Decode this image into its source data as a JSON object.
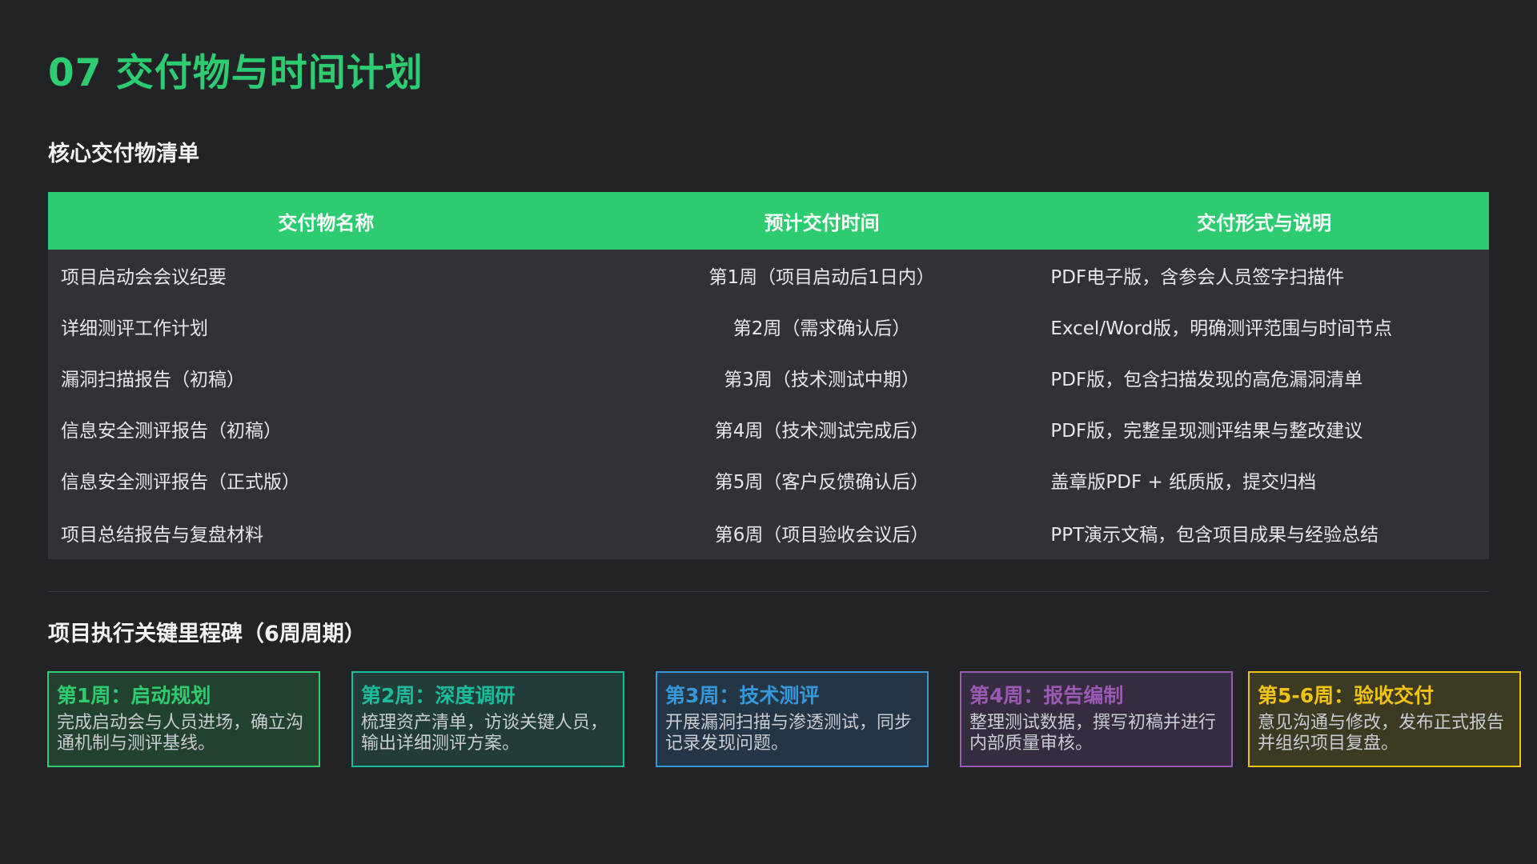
{
  "page": {
    "title": "07 交付物与时间计划"
  },
  "deliverables": {
    "section_title": "核心交付物清单",
    "columns": [
      "交付物名称",
      "预计交付时间",
      "交付形式与说明"
    ],
    "rows": [
      [
        "项目启动会会议纪要",
        "第1周（项目启动后1日内）",
        "PDF电子版，含参会人员签字扫描件"
      ],
      [
        "详细测评工作计划",
        "第2周（需求确认后）",
        "Excel/Word版，明确测评范围与时间节点"
      ],
      [
        "漏洞扫描报告（初稿）",
        "第3周（技术测试中期）",
        "PDF版，包含扫描发现的高危漏洞清单"
      ],
      [
        "信息安全测评报告（初稿）",
        "第4周（技术测试完成后）",
        "PDF版，完整呈现测评结果与整改建议"
      ],
      [
        "信息安全测评报告（正式版）",
        "第5周（客户反馈确认后）",
        "盖章版PDF + 纸质版，提交归档"
      ],
      [
        "项目总结报告与复盘材料",
        "第6周（项目验收会议后）",
        "PPT演示文稿，包含项目成果与经验总结"
      ]
    ]
  },
  "milestones": {
    "section_title": "项目执行关键里程碑（6周周期）",
    "items": [
      {
        "heading": "第1周：启动规划",
        "body": "完成启动会与人员进场，确立沟通机制与测评基线。",
        "color": "#2ecc71"
      },
      {
        "heading": "第2周：深度调研",
        "body": "梳理资产清单，访谈关键人员，输出详细测评方案。",
        "color": "#1abc9c"
      },
      {
        "heading": "第3周：技术测评",
        "body": "开展漏洞扫描与渗透测试，同步记录发现问题。",
        "color": "#3498db"
      },
      {
        "heading": "第4周：报告编制",
        "body": "整理测试数据，撰写初稿并进行内部质量审核。",
        "color": "#9b59b6"
      },
      {
        "heading": "第5-6周：验收交付",
        "body": "意见沟通与修改，发布正式报告并组织项目复盘。",
        "color": "#f1c40f"
      }
    ]
  },
  "colors": {
    "background": "#212327",
    "accent": "#2ecc71",
    "table_body": "#303237"
  }
}
